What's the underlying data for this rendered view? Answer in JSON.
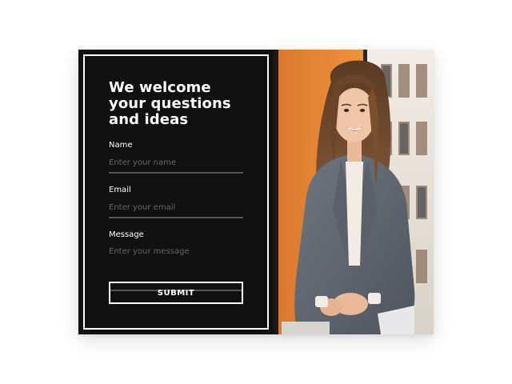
{
  "form": {
    "title": "We welcome your questions and ideas",
    "fields": {
      "name": {
        "label": "Name",
        "placeholder": "Enter your name"
      },
      "email": {
        "label": "Email",
        "placeholder": "Enter your email"
      },
      "message": {
        "label": "Message",
        "placeholder": "Enter your message"
      }
    },
    "submit_label": "SUBMIT"
  },
  "colors": {
    "panel_bg": "#111111",
    "accent_orange": "#e8893a",
    "text": "#ffffff"
  }
}
